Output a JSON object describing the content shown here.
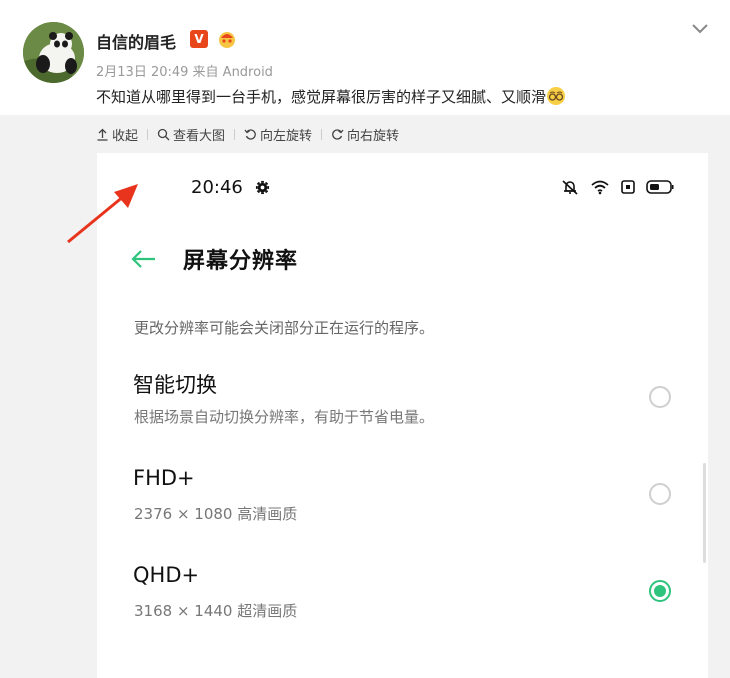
{
  "post": {
    "username": "自信的眉毛",
    "verified_badge": "V",
    "meta": "2月13日 20:49 来自 Android",
    "text": "不知道从哪里得到一台手机，感觉屏幕很厉害的样子又细腻、又顺滑",
    "emoji_icon": "blush-smile-emoji",
    "collapse_icon": "chevron-down-icon"
  },
  "toolbar": {
    "collapse": "收起",
    "view_large": "查看大图",
    "rotate_left": "向左旋转",
    "rotate_right": "向右旋转"
  },
  "phone": {
    "status": {
      "time": "20:46",
      "icons": [
        "gear-icon",
        "silent-bell-icon",
        "wifi-icon",
        "nfc-icon",
        "battery-icon"
      ]
    },
    "page_title": "屏幕分辨率",
    "notice": "更改分辨率可能会关闭部分正在运行的程序。",
    "options": [
      {
        "title": "智能切换",
        "subtitle": "根据场景自动切换分辨率，有助于节省电量。",
        "selected": false
      },
      {
        "title": "FHD+",
        "subtitle": "2376 × 1080 高清画质",
        "selected": false
      },
      {
        "title": "QHD+",
        "subtitle": "3168 × 1440 超清画质",
        "selected": true
      }
    ],
    "accent_color": "#2fc47d"
  },
  "annotation": {
    "arrow_color": "#e8341c"
  }
}
